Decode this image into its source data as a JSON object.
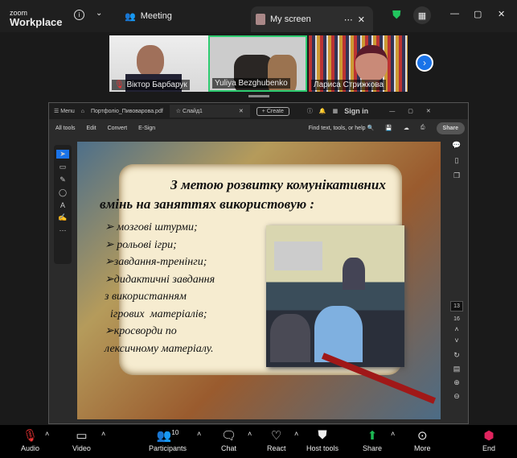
{
  "zoom": {
    "logo_top": "zoom",
    "logo_bottom": "Workplace",
    "meeting_tab": "Meeting",
    "my_screen_tab": "My screen"
  },
  "participants": [
    {
      "name": "Віктор Барбарук",
      "muted": true
    },
    {
      "name": "Yuliya Bezghubenko",
      "active": true
    },
    {
      "name": "Лариса Стрижкова"
    }
  ],
  "acrobat": {
    "menu": "Menu",
    "file_tab": "Портфоліо_Пивоварова.pdf",
    "slide_tab": "Слайд1",
    "create": "Create",
    "sign_in": "Sign in",
    "tools": [
      "All tools",
      "Edit",
      "Convert",
      "E-Sign"
    ],
    "search_placeholder": "Find text, tools, or help",
    "share": "Share",
    "page_current": "13",
    "page_total": "16"
  },
  "slide": {
    "title1": "З метою розвитку комунікативних",
    "title2": "вмінь на заняттях використовую :",
    "items": [
      "➢  мозгові штурми;",
      "➢ рольові ігри;",
      "➢завдання-тренінги;",
      "➢дидактичні завдання",
      "з використанням",
      "  ігрових  матеріалів;",
      "➢кросворди по",
      "лексичному матеріалу."
    ]
  },
  "toolbar": {
    "audio": "Audio",
    "video": "Video",
    "participants": "Participants",
    "participants_count": "10",
    "chat": "Chat",
    "react": "React",
    "host_tools": "Host tools",
    "share": "Share",
    "more": "More",
    "end": "End"
  },
  "colors": {
    "active_border": "#2ecc71",
    "share_green": "#1db954",
    "end_red": "#e0245e",
    "blue": "#1a73e8"
  }
}
